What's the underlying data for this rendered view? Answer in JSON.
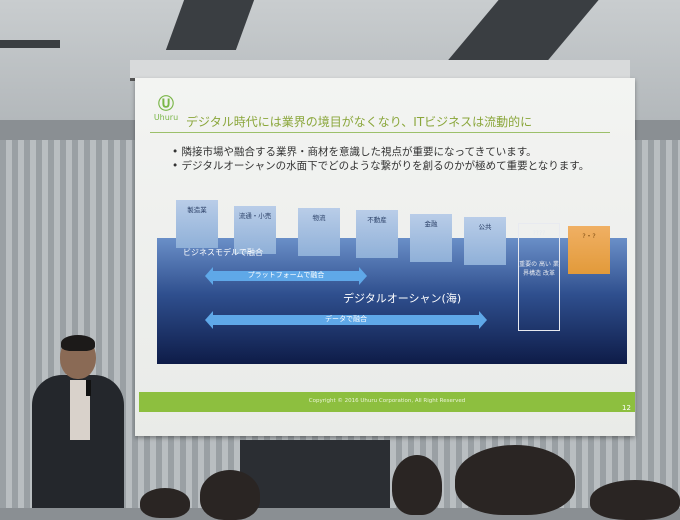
{
  "slide": {
    "logo_text": "Uhuru",
    "title": "デジタル時代には業界の境目がなくなり、ITビジネスは流動的に",
    "bullets": [
      "隣接市場や融合する業界・商材を意識した視点が重要になってきています。",
      "デジタルオーシャンの水面下でどのような繋がりを創るのかが極めて重要となります。"
    ],
    "categories": [
      "製造業",
      "流通・小売",
      "物流",
      "不動産",
      "金融",
      "公共",
      "????",
      "?・?"
    ],
    "outline_box_text": "重要の 高い 業界構造 改革",
    "business_model_label": "ビジネスモデルで融合",
    "platform_label": "プラットフォームで融合",
    "ocean_label": "デジタルオーシャン(海)",
    "data_label": "データで融合",
    "footer": "Copyright © 2016 Uhuru Corporation, All Right Reserved",
    "page_number": "12"
  },
  "colors": {
    "accent_green": "#8dbf3f",
    "arrow_blue": "#5fa8e8",
    "ocean_dark": "#0e1c48"
  }
}
